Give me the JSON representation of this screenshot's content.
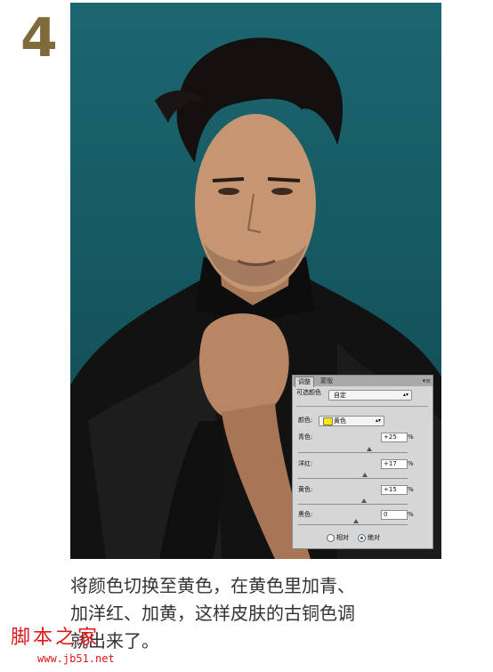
{
  "step": {
    "number": "4"
  },
  "panel": {
    "tabs": [
      "调整",
      "蒙版"
    ],
    "menu_icon": "panel-menu-icon",
    "mode_label": "可选颜色",
    "preset_value": "自定",
    "colors_label": "颜色:",
    "colors_value": "黄色",
    "colors_swatch_color": "#ffe600",
    "sliders": [
      {
        "label": "青色:",
        "value": "+25",
        "unit": "%"
      },
      {
        "label": "洋红:",
        "value": "+17",
        "unit": "%"
      },
      {
        "label": "黄色:",
        "value": "+15",
        "unit": "%"
      },
      {
        "label": "黑色:",
        "value": "0",
        "unit": "%"
      }
    ],
    "method": {
      "relative": "相对",
      "absolute": "绝对",
      "selected": "absolute"
    }
  },
  "caption": {
    "lines": [
      "将颜色切换至黄色，在黄色里加青、",
      "加洋红、加黄，这样皮肤的古铜色调",
      "就出来了。"
    ]
  },
  "watermark": {
    "text": "脚本之家",
    "url": "www.jb51.net"
  }
}
